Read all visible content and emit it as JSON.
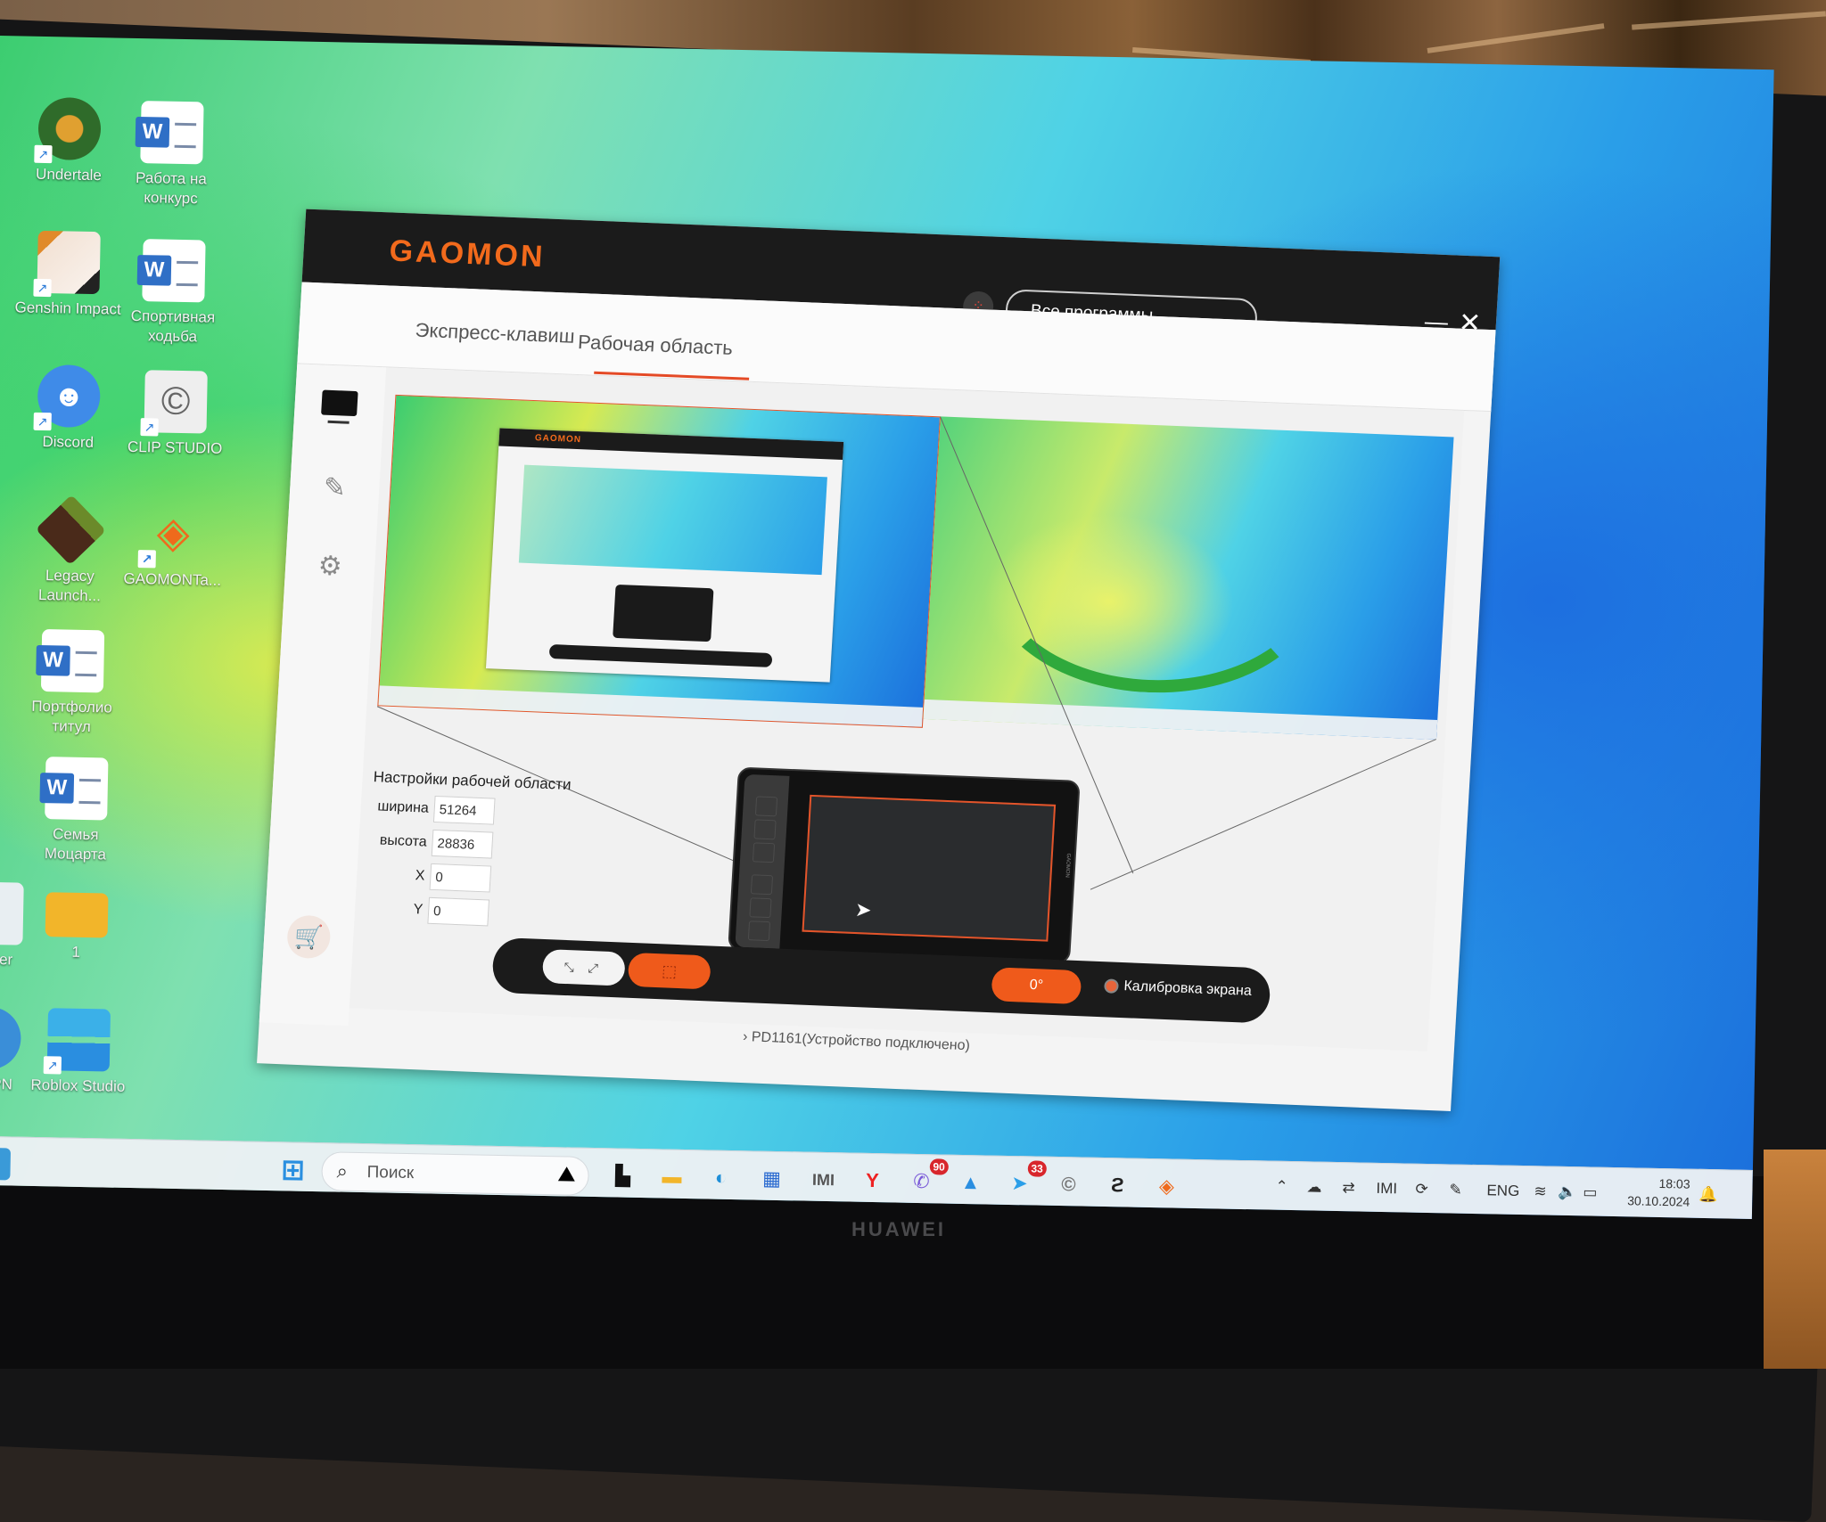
{
  "photo": {
    "laptop_brand": "HUAWEI"
  },
  "desktop": {
    "icons": [
      {
        "label": "Undertale",
        "icon": "undertale-icon",
        "shortcut": true
      },
      {
        "label": "Работа на конкурс",
        "icon": "word-document-icon",
        "shortcut": false
      },
      {
        "label": "Genshin Impact",
        "icon": "genshin-icon",
        "shortcut": true
      },
      {
        "label": "Спортивная ходьба",
        "icon": "word-document-icon",
        "shortcut": false
      },
      {
        "label": "Discord",
        "icon": "discord-icon",
        "shortcut": true
      },
      {
        "label": "CLIP STUDIO",
        "icon": "clip-studio-icon",
        "shortcut": true
      },
      {
        "label": "Legacy Launch...",
        "icon": "minecraft-icon",
        "shortcut": true
      },
      {
        "label": "GAOMONTa...",
        "icon": "gaomon-tablet-icon",
        "shortcut": true
      },
      {
        "label": "Портфолио титул",
        "icon": "word-document-icon",
        "shortcut": false
      },
      {
        "label": "Семья Моцарта",
        "icon": "word-document-icon",
        "shortcut": false
      },
      {
        "label": "1",
        "icon": "folder-icon",
        "shortcut": false
      },
      {
        "label": "Roblox Studio",
        "icon": "roblox-studio-icon",
        "shortcut": true
      },
      {
        "label": "Player",
        "icon": "player-icon",
        "shortcut": false
      },
      {
        "label": "in VPN",
        "icon": "vpn-icon",
        "shortcut": false
      }
    ]
  },
  "app": {
    "logo": "GAOMON",
    "app_selector": {
      "value": "Все программы"
    },
    "tabs": [
      {
        "label": "Экспресс-клавиш",
        "active": false
      },
      {
        "label": "Рабочая область",
        "active": true
      }
    ],
    "sidebar": [
      {
        "icon": "display-icon",
        "active": true
      },
      {
        "icon": "pen-icon",
        "active": false
      },
      {
        "icon": "gear-icon",
        "active": false
      },
      {
        "icon": "shopping-cart-icon",
        "active": false
      }
    ],
    "mini_logo": "GAOMON",
    "work_area_settings": {
      "title": "Настройки рабочей области",
      "fields": [
        {
          "label": "ширина",
          "value": "51264"
        },
        {
          "label": "высота",
          "value": "28836"
        },
        {
          "label": "X",
          "value": "0"
        },
        {
          "label": "Y",
          "value": "0"
        }
      ]
    },
    "toolbar": {
      "full_area_icon": "⤡ ⤢",
      "select_area_icon": "⬚",
      "rotation": "0°",
      "calibration_label": "Калибровка экрана"
    },
    "device_status": "PD1161(Устройство подключено)",
    "colors": {
      "accent": "#ef5a1b",
      "titlebar": "#1b1b1b"
    }
  },
  "taskbar": {
    "search_placeholder": "Поиск",
    "apps": [
      {
        "name": "start",
        "icon": "windows-start-icon"
      },
      {
        "name": "task-view",
        "icon": "task-view-icon"
      },
      {
        "name": "file-explorer",
        "icon": "folder-icon"
      },
      {
        "name": "edge",
        "icon": "edge-icon"
      },
      {
        "name": "store",
        "icon": "store-icon"
      },
      {
        "name": "huawei-pc-manager",
        "icon": "mi-icon"
      },
      {
        "name": "yandex-browser",
        "icon": "yandex-icon"
      },
      {
        "name": "viber",
        "icon": "viber-icon",
        "badge": "90"
      },
      {
        "name": "photos",
        "icon": "photos-icon"
      },
      {
        "name": "telegram",
        "icon": "telegram-icon",
        "badge": "33"
      },
      {
        "name": "clip-studio",
        "icon": "clip-studio-icon"
      },
      {
        "name": "clip-studio-paint",
        "icon": "clip-studio-paint-icon"
      },
      {
        "name": "gaomon-tablet",
        "icon": "gaomon-tablet-icon"
      }
    ],
    "tray": {
      "language": "ENG",
      "time": "18:03",
      "date": "30.10.2024"
    }
  }
}
